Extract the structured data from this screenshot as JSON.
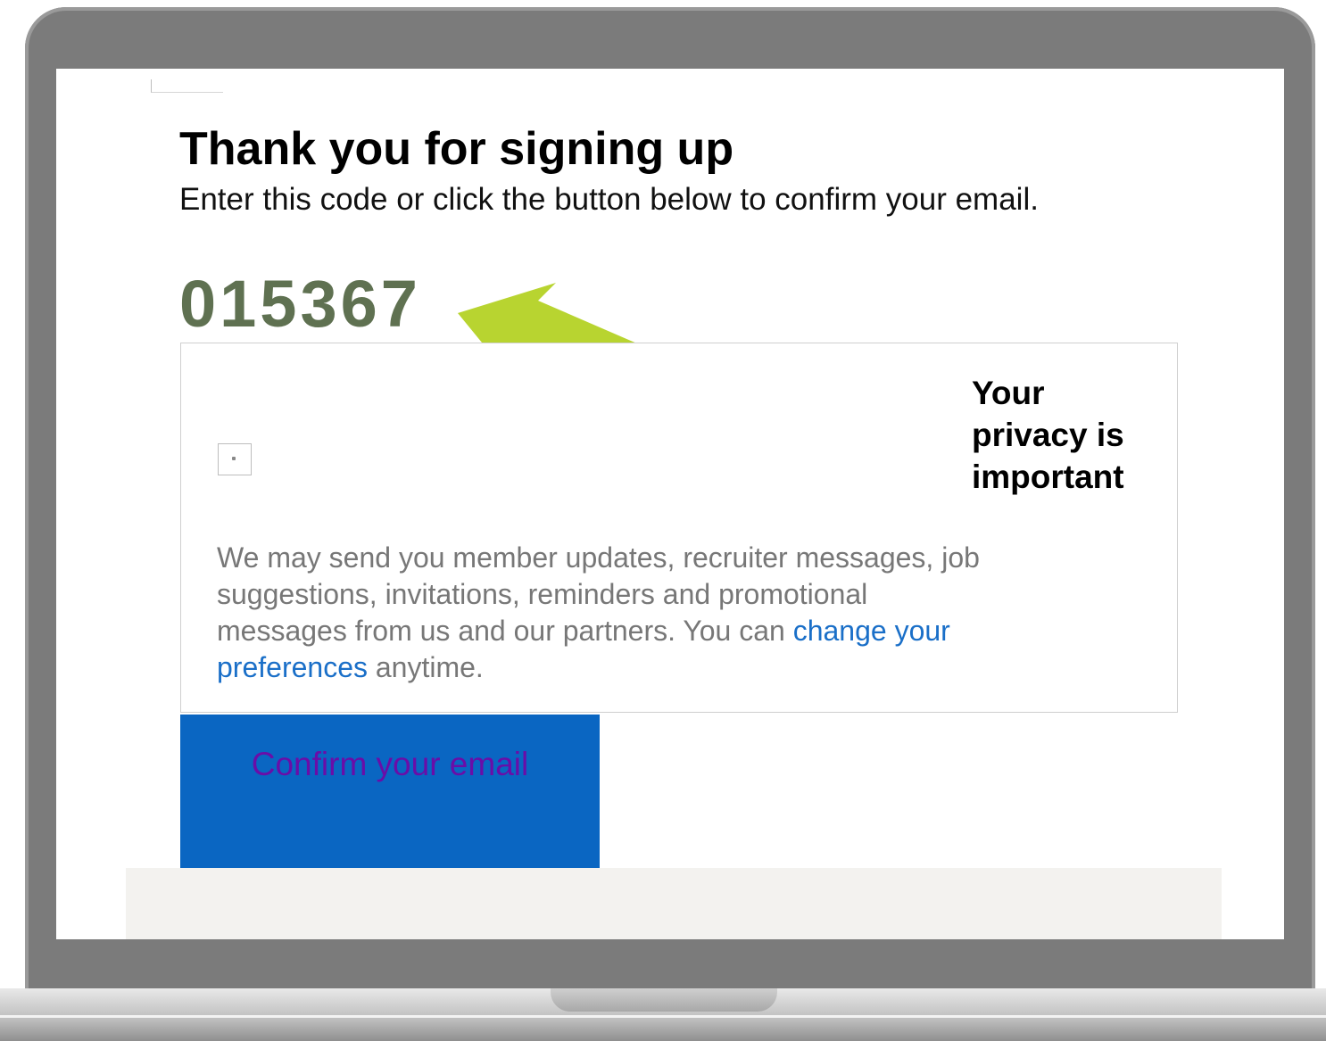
{
  "email": {
    "title": "Thank you for signing up",
    "subtitle": "Enter this code or click the button below to confirm your email.",
    "code": "015367",
    "arrow_color": "#b8d430",
    "code_color": "#5f7151"
  },
  "privacy": {
    "heading": "Your privacy is important",
    "text_before_link": "We may send you member updates, recruiter messages, job suggestions, invitations, reminders and promotional messages from us and our partners. You can ",
    "link_text": "change your preferences",
    "text_after_link": " anytime.",
    "link_color": "#1a6fc8"
  },
  "confirm_button": {
    "label": "Confirm your email",
    "background": "#0a66c2",
    "text_color": "#6a0da8"
  },
  "icons": {
    "arrow": "arrow-pointing-left-up-icon",
    "checkbox": "checkbox-icon",
    "logo": "logo-placeholder-icon"
  }
}
